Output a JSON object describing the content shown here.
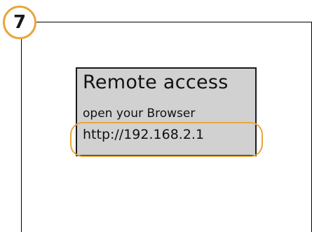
{
  "step": {
    "number": "7",
    "accent_color": "#e8a63c"
  },
  "device_screen": {
    "title": "Remote access",
    "instruction": "open your Browser",
    "url": "http://192.168.2.1",
    "background_color": "#d1d1d1"
  }
}
